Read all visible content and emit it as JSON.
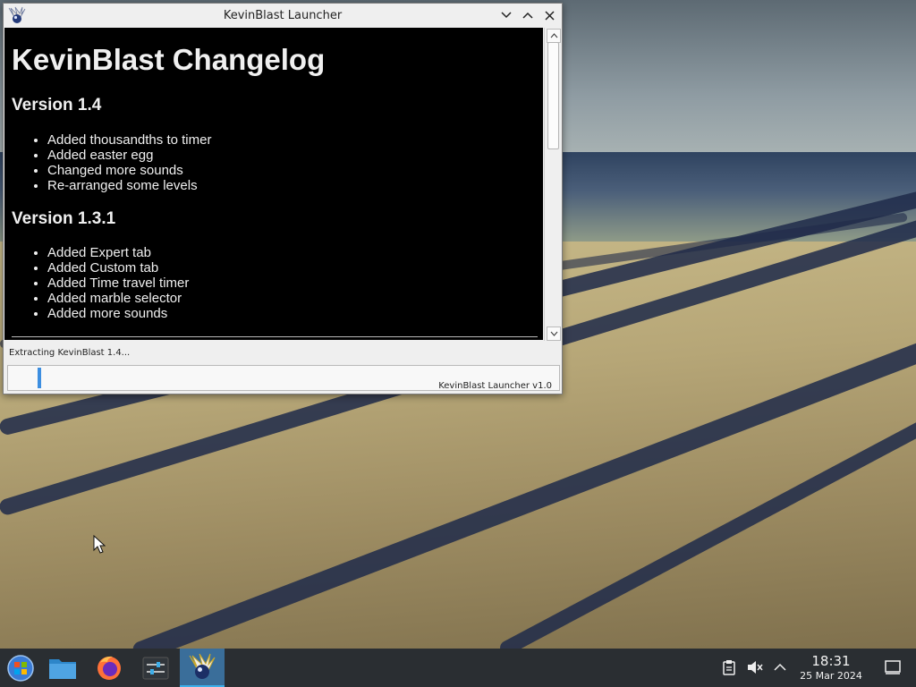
{
  "window": {
    "title": "KevinBlast Launcher",
    "controls": {
      "minimize": "⌄",
      "maximize": "⌃",
      "close": "✕"
    }
  },
  "changelog": {
    "heading": "KevinBlast Changelog",
    "versions": [
      {
        "title": "Version 1.4",
        "items": [
          "Added thousandths to timer",
          "Added easter egg",
          "Changed more sounds",
          "Re-arranged some levels"
        ]
      },
      {
        "title": "Version 1.3.1",
        "items": [
          "Added Expert tab",
          "Added Custom tab",
          "Added Time travel timer",
          "Added marble selector",
          "Added more sounds"
        ]
      }
    ]
  },
  "status": {
    "text": "Extracting KevinBlast 1.4...",
    "progress_fraction": 0.06,
    "version_label": "KevinBlast Launcher v1.0"
  },
  "taskbar": {
    "apps": [
      "start-menu-icon",
      "file-manager-icon",
      "firefox-icon",
      "settings-icon",
      "kevinblast-icon"
    ],
    "tray": [
      "clipboard-icon",
      "volume-muted-icon",
      "tray-expand-icon",
      "show-desktop-icon"
    ],
    "time": "18:31",
    "date": "25 Mar 2024"
  }
}
